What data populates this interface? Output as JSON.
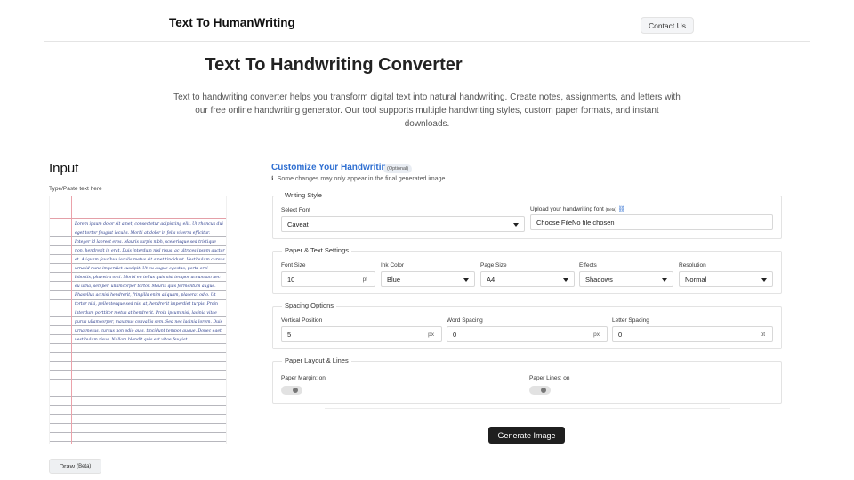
{
  "header": {
    "brand": "Text To HumanWriting",
    "contact_label": "Contact Us"
  },
  "hero": {
    "title": "Text To Handwriting Converter",
    "description": "Text to handwriting converter helps you transform digital text into natural handwriting. Create notes, assignments, and letters with our free online handwriting generator. Our tool supports multiple handwriting styles, custom paper formats, and instant downloads."
  },
  "input": {
    "title": "Input",
    "subtitle": "Type/Paste text here",
    "text": "Lorem ipsum dolor sit amet, consectetur adipiscing elit. Ut rhoncus dui eget tortor feugiat iaculis. Morbi at dolor in felis viverra efficitur. Integer id laoreet eros. Mauris turpis nibh, scelerisque sed tristique non, hendrerit in erat. Duis interdum nisl risus, ac ultrices ipsum auctor et. Aliquam faucibus iaculis metus sit amet tincidunt. Vestibulum cursus urna id nunc imperdiet suscipit. Ut eu augue egestas, porta orci lobortis, pharetra orci. Morbi eu tellus quis nisl tempor accumsan nec eu urna, semper, ullamcorper tortor. Mauris quis fermentum augue. Phasellus ac nisl hendrerit, fringilla enim aliquam, placerat odio. Ut tortor nisi, pellentesque sed nisi at, hendrerit imperdiet turpis. Proin interdum porttitor metus at hendrerit. Proin ipsum nisl, lacinia vitae purus ullamcorper, maximus convallis sem. Sed nec lacinia lorem. Duis urna metus, cursus non odio quis, tincidunt tempor augue. Donec eget vestibulum risus. Nullam blandit quis est vitae feugiat.",
    "draw_label": "Draw",
    "draw_beta": "(Beta)"
  },
  "customize": {
    "title": "Customize Your Handwriting",
    "optional": "(Optional)",
    "notice_icon": "ℹ",
    "notice": "Some changes may only appear in the final generated image"
  },
  "writing_style": {
    "legend": "Writing Style",
    "font_label": "Select Font",
    "font_value": "Caveat",
    "upload_label": "Upload your handwriting font",
    "upload_beta": "(Beta)",
    "upload_link_icon": "⛓",
    "upload_value": "Choose FileNo file chosen"
  },
  "paper_text": {
    "legend": "Paper & Text Settings",
    "font_size_label": "Font Size",
    "font_size_value": "10",
    "font_size_unit": "pt",
    "ink_label": "Ink Color",
    "ink_value": "Blue",
    "page_size_label": "Page Size",
    "page_size_value": "A4",
    "effects_label": "Effects",
    "effects_value": "Shadows",
    "resolution_label": "Resolution",
    "resolution_value": "Normal"
  },
  "spacing": {
    "legend": "Spacing Options",
    "vertical_label": "Vertical Position",
    "vertical_value": "5",
    "vertical_unit": "px",
    "word_label": "Word Spacing",
    "word_value": "0",
    "word_unit": "px",
    "letter_label": "Letter Spacing",
    "letter_value": "0",
    "letter_unit": "pt"
  },
  "layout": {
    "legend": "Paper Layout & Lines",
    "margin_label": "Paper Margin: on",
    "lines_label": "Paper Lines: on"
  },
  "generate_label": "Generate Image",
  "colors": {
    "accent": "#2f6fd1",
    "ink": "#283a8a",
    "margin_line": "#eba2aa",
    "button_dark": "#1f1f1f"
  }
}
